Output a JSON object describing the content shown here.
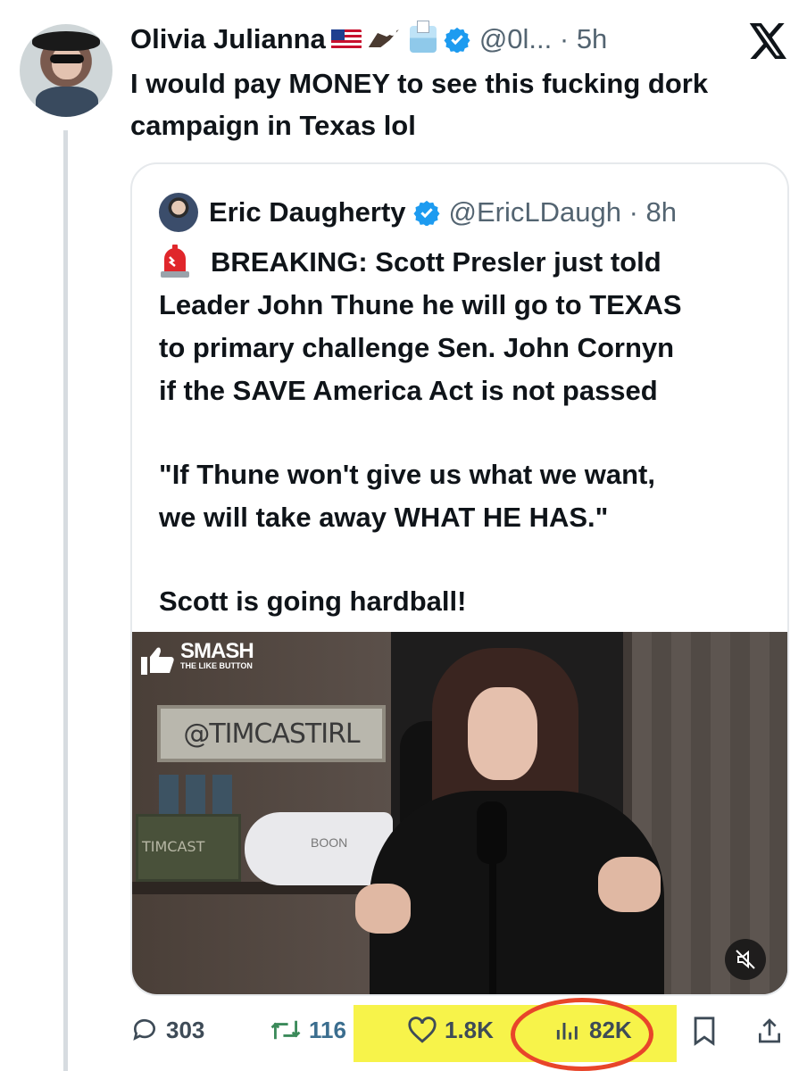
{
  "tweet": {
    "author_name": "Olivia Julianna",
    "handle": "@0l...",
    "time": "5h",
    "text": "I would pay MONEY to see this fucking dork campaign in Texas lol"
  },
  "quoted": {
    "author_name": "Eric Daugherty",
    "handle": "@EricLDaugh",
    "time": "8h",
    "lines": [
      "BREAKING: Scott Presler just told",
      "Leader John Thune he will go to TEXAS",
      "to primary challenge Sen. John Cornyn",
      "if the SAVE America Act is not passed",
      "\"If Thune won't give us what we want,",
      "we will take away WHAT HE HAS.\"",
      "Scott is going hardball!"
    ],
    "video": {
      "overlay_smash": "SMASH",
      "overlay_like": "THE LIKE BUTTON",
      "sign_text": "@TIMCASTIRL",
      "crate_text": "TIMCAST",
      "board_text": "BOON"
    }
  },
  "actions": {
    "replies": "303",
    "reposts": "116",
    "likes": "1.8K",
    "views": "82K"
  },
  "colors": {
    "accent": "#1d9bf0",
    "highlight": "#f7f34a",
    "circle": "#e8452a"
  }
}
